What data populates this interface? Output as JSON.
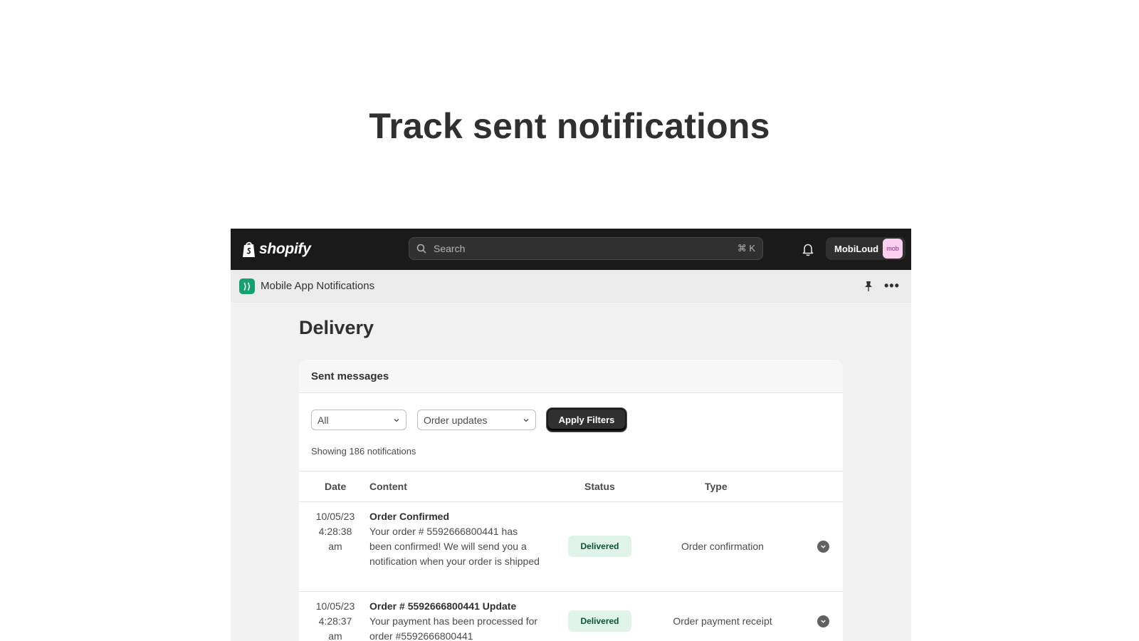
{
  "hero": {
    "title": "Track sent notifications"
  },
  "topbar": {
    "brand": "shopify",
    "search_placeholder": "Search",
    "shortcut": "⌘ K",
    "account_name": "MobiLoud",
    "avatar_text": "mob"
  },
  "appbar": {
    "app_icon_text": "⟩⟩",
    "app_name": "Mobile App Notifications"
  },
  "page": {
    "title": "Delivery"
  },
  "card": {
    "header": "Sent messages",
    "filter_status": "All",
    "filter_type": "Order updates",
    "apply_label": "Apply Filters",
    "showing": "Showing 186 notifications"
  },
  "table": {
    "headers": {
      "date": "Date",
      "content": "Content",
      "status": "Status",
      "type": "Type"
    },
    "rows": [
      {
        "date": [
          "10/05/23",
          "4:28:38",
          "am"
        ],
        "title": "Order Confirmed",
        "body": "Your order # 5592666800441 has been confirmed! We will send you a notification when your order is shipped",
        "status": "Delivered",
        "type": "Order confirmation"
      },
      {
        "date": [
          "10/05/23",
          "4:28:37",
          "am"
        ],
        "title": "Order # 5592666800441 Update",
        "body": "Your payment has been processed for order #5592666800441",
        "status": "Delivered",
        "type": "Order payment receipt"
      }
    ]
  },
  "colors": {
    "topbar": "#1a1a1a",
    "badge_bg": "#dff3e8",
    "badge_text": "#0c5132",
    "app_icon": "#14a06f"
  }
}
